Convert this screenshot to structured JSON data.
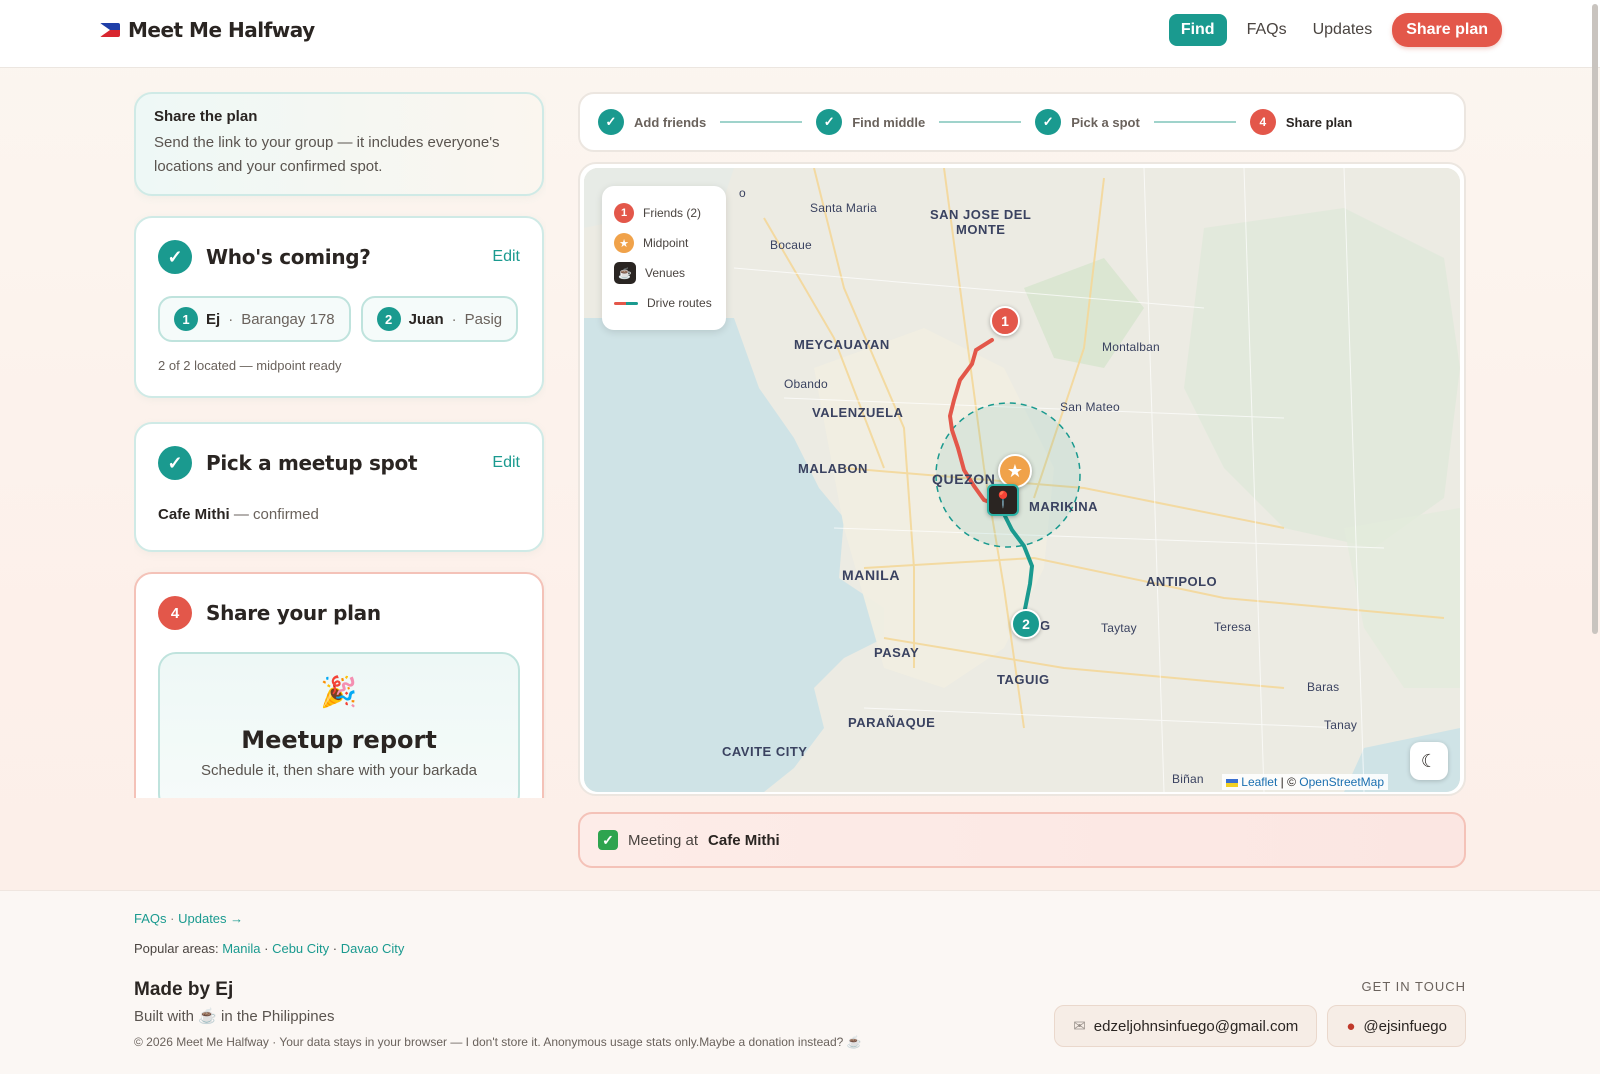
{
  "header": {
    "brand": "Meet Me Halfway",
    "nav": {
      "find": "Find",
      "faqs": "FAQs",
      "updates": "Updates",
      "share": "Share plan"
    }
  },
  "intro": {
    "title": "Share the plan",
    "text": "Send the link to your group — it includes everyone's locations and your confirmed spot."
  },
  "who": {
    "title": "Who's coming?",
    "edit": "Edit",
    "friends": [
      {
        "num": "1",
        "name": "Ej",
        "sep": "·",
        "area": "Barangay 178"
      },
      {
        "num": "2",
        "name": "Juan",
        "sep": "·",
        "area": "Pasig"
      }
    ],
    "status": "2 of 2 located — midpoint ready"
  },
  "pick": {
    "title": "Pick a meetup spot",
    "edit": "Edit",
    "venue": "Cafe Mithi",
    "status": " — confirmed"
  },
  "share": {
    "num": "4",
    "title": "Share your plan",
    "report_icon": "🎉",
    "report_title": "Meetup report",
    "report_sub": "Schedule it, then share with your barkada"
  },
  "stepper": {
    "steps": [
      {
        "label": "Add friends",
        "done": true
      },
      {
        "label": "Find middle",
        "done": true
      },
      {
        "label": "Pick a spot",
        "done": true
      },
      {
        "label": "Share plan",
        "num": "4",
        "done": false
      }
    ]
  },
  "map": {
    "legend": {
      "friends": "Friends (2)",
      "midpoint": "Midpoint",
      "venues": "Venues",
      "routes": "Drive routes",
      "friend_num": "1"
    },
    "labels": {
      "o": "o",
      "santa_maria": "Santa Maria",
      "san_jose": "SAN JOSE DEL",
      "monte": "MONTE",
      "bocaue": "Bocaue",
      "meycauayan": "MEYCAUAYAN",
      "montalban": "Montalban",
      "obando": "Obando",
      "valenzuela": "VALENZUELA",
      "san_mateo": "San Mateo",
      "malabon": "MALABON",
      "quezon": "QUEZON",
      "marikina": "MARIKINA",
      "manila": "MANILA",
      "antipolo": "ANTIPOLO",
      "taytay": "Taytay",
      "teresa": "Teresa",
      "pasay": "PASAY",
      "taguig": "TAGUIG",
      "baras": "Baras",
      "paranaque": "PARAÑAQUE",
      "tanay": "Tanay",
      "cavite": "CAVITE CITY",
      "binan": "Biñan",
      "pasig_frag": "G"
    },
    "pins": {
      "friend1": "1",
      "friend2": "2"
    },
    "attribution": {
      "leaflet": "Leaflet",
      "sep": " | © ",
      "osm": "OpenStreetMap"
    },
    "colors": {
      "route1": "#e3574a",
      "route2": "#1a9a8f",
      "water": "#cfe3e6",
      "land": "#ecebe3"
    }
  },
  "meeting": {
    "prefix": "Meeting at",
    "venue": "Cafe Mithi"
  },
  "footer": {
    "faqs": "FAQs",
    "dot": "·",
    "updates": "Updates →",
    "areas_label": "Popular areas:",
    "areas": [
      "Manila",
      "Cebu City",
      "Davao City"
    ],
    "made": "Made by Ej",
    "built": "Built with ☕ in the Philippines",
    "copy": "© 2026 Meet Me Halfway · Your data stays in your browser — I don't store it. Anonymous usage stats only.Maybe a donation instead? ☕",
    "touch": "GET IN TOUCH",
    "email": "edzeljohnsinfuego@gmail.com",
    "handle": "@ejsinfuego"
  }
}
